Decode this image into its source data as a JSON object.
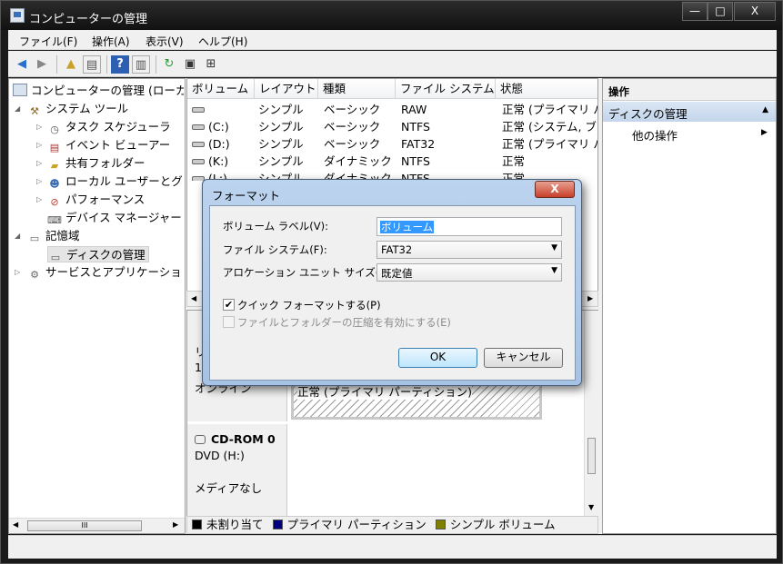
{
  "window": {
    "title": "コンピューターの管理",
    "min": "—",
    "max": "□",
    "close": "X"
  },
  "menu": [
    "ファイル(F)",
    "操作(A)",
    "表示(V)",
    "ヘルプ(H)"
  ],
  "tree": {
    "root": "コンピューターの管理 (ローカ",
    "system_tools": "システム ツール",
    "task_scheduler": "タスク スケジューラ",
    "event_viewer": "イベント ビューアー",
    "shared_folders": "共有フォルダー",
    "local_users": "ローカル ユーザーとグ",
    "performance": "パフォーマンス",
    "device_manager": "デバイス マネージャー",
    "storage": "記憶域",
    "disk_management": "ディスクの管理",
    "services": "サービスとアプリケーショ",
    "scroll_thumb": "III"
  },
  "volumes": {
    "headers": [
      "ボリューム",
      "レイアウト",
      "種類",
      "ファイル システム",
      "状態"
    ],
    "rows": [
      {
        "volume": "",
        "layout": "シンプル",
        "type": "ベーシック",
        "fs": "RAW",
        "status": "正常 (プライマリ パ"
      },
      {
        "volume": "(C:)",
        "layout": "シンプル",
        "type": "ベーシック",
        "fs": "NTFS",
        "status": "正常 (システム, ブー"
      },
      {
        "volume": "(D:)",
        "layout": "シンプル",
        "type": "ベーシック",
        "fs": "FAT32",
        "status": "正常 (プライマリ パ"
      },
      {
        "volume": "(K:)",
        "layout": "シンプル",
        "type": "ダイナミック",
        "fs": "NTFS",
        "status": "正常"
      },
      {
        "volume": "(L:)",
        "layout": "シンプル",
        "type": "ダイナミック",
        "fs": "NTFS",
        "status": "正常"
      }
    ]
  },
  "graphical": {
    "disk_partial_1": "リ",
    "disk_partial_2": "1",
    "disk_partial_3": "オンライン",
    "partition_status": "正常 (プライマリ パーティション)",
    "cdrom_name": "CD-ROM 0",
    "cdrom_drive": "DVD (H:)",
    "cdrom_media": "メディアなし"
  },
  "legend": [
    {
      "label": "未割り当て",
      "color": "#000000"
    },
    {
      "label": "プライマリ パーティション",
      "color": "#000080"
    },
    {
      "label": "シンプル ボリューム",
      "color": "#808000"
    }
  ],
  "actions": {
    "header": "操作",
    "section": "ディスクの管理",
    "item": "他の操作"
  },
  "dialog": {
    "title": "フォーマット",
    "close": "X",
    "volume_label_label": "ボリューム ラベル(V):",
    "volume_label_value": "ボリューム",
    "fs_label": "ファイル システム(F):",
    "fs_value": "FAT32",
    "alloc_label": "アロケーション ユニット サイズ(A):",
    "alloc_value": "既定値",
    "quick_format": "クイック フォーマットする(P)",
    "quick_format_checked": true,
    "compression": "ファイルとフォルダーの圧縮を有効にする(E)",
    "ok": "OK",
    "cancel": "キャンセル"
  }
}
